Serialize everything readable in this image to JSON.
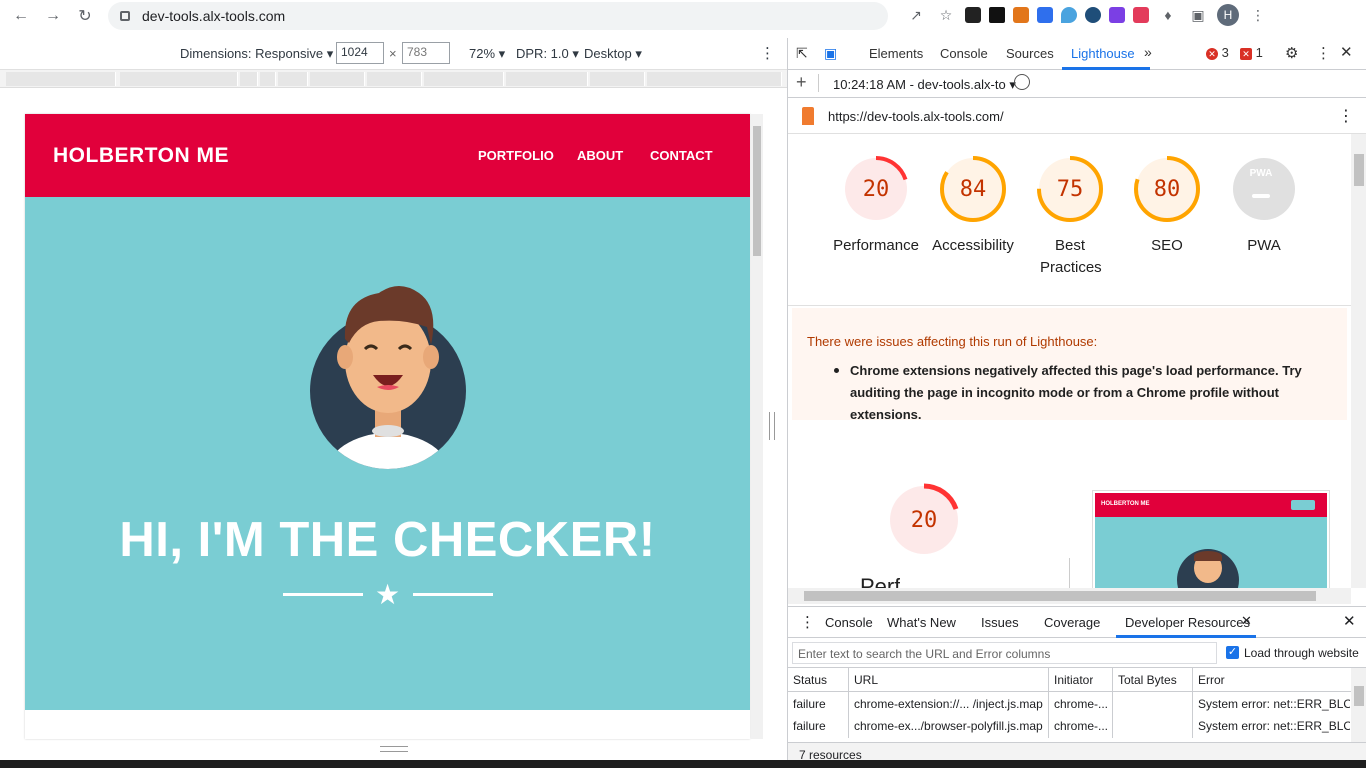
{
  "browser": {
    "url": "dev-tools.alx-tools.com",
    "profile_initial": "H"
  },
  "device_toolbar": {
    "dimensions_label": "Dimensions: Responsive",
    "width": "1024",
    "height": "783",
    "times": "×",
    "zoom": "72%",
    "dpr": "DPR: 1.0",
    "device": "Desktop"
  },
  "site": {
    "logo": "HOLBERTON ME",
    "nav": [
      "PORTFOLIO",
      "ABOUT",
      "CONTACT"
    ],
    "hero_title": "HI, I'M THE CHECKER!",
    "colors": {
      "header": "#e1003b",
      "hero": "#7acdd3"
    }
  },
  "devtools": {
    "tabs": [
      "Elements",
      "Console",
      "Sources",
      "Lighthouse"
    ],
    "more": "»",
    "errors_count": "3",
    "issues_count": "1",
    "report_time": "10:24:18 AM - dev-tools.alx-to",
    "report_url": "https://dev-tools.alx-tools.com/",
    "scores": [
      {
        "value": "20",
        "label": "Performance",
        "fraction": 0.2,
        "color": "#ff3333",
        "bg": "#fde9e9"
      },
      {
        "value": "84",
        "label": "Accessibility",
        "fraction": 0.84,
        "color": "#ffa400",
        "bg": "#fff3e6"
      },
      {
        "value": "75",
        "label": "Best Practices",
        "fraction": 0.75,
        "color": "#ffa400",
        "bg": "#fff3e6"
      },
      {
        "value": "80",
        "label": "SEO",
        "fraction": 0.8,
        "color": "#ffa400",
        "bg": "#fff3e6"
      },
      {
        "value": "",
        "label": "PWA",
        "fraction": 0,
        "color": "#cccccc",
        "bg": "#e0e0e0"
      }
    ],
    "pwa_badge": "PWA",
    "warning_title": "There were issues affecting this run of Lighthouse:",
    "warning_item": "Chrome extensions negatively affected this page's load performance. Try auditing the page in incognito mode or from a Chrome profile without extensions.",
    "big_score": "20",
    "big_score_partial_label": "Perf",
    "thumbnail_logo": "HOLBERTON ME",
    "drawer": {
      "tabs": [
        "Console",
        "What's New",
        "Issues",
        "Coverage",
        "Developer Resources"
      ],
      "filter_placeholder": "Enter text to search the URL and Error columns",
      "load_through_website": "Load through website",
      "columns": [
        "Status",
        "URL",
        "Initiator",
        "Total Bytes",
        "Error"
      ],
      "rows": [
        {
          "status": "failure",
          "url": "chrome-extension://... /inject.js.map",
          "initiator": "chrome-...",
          "bytes": "",
          "error": "System error: net::ERR_BLO..."
        },
        {
          "status": "failure",
          "url": "chrome-ex.../browser-polyfill.js.map",
          "initiator": "chrome-...",
          "bytes": "",
          "error": "System error: net::ERR_BLO..."
        }
      ],
      "resources": "7 resources"
    }
  }
}
